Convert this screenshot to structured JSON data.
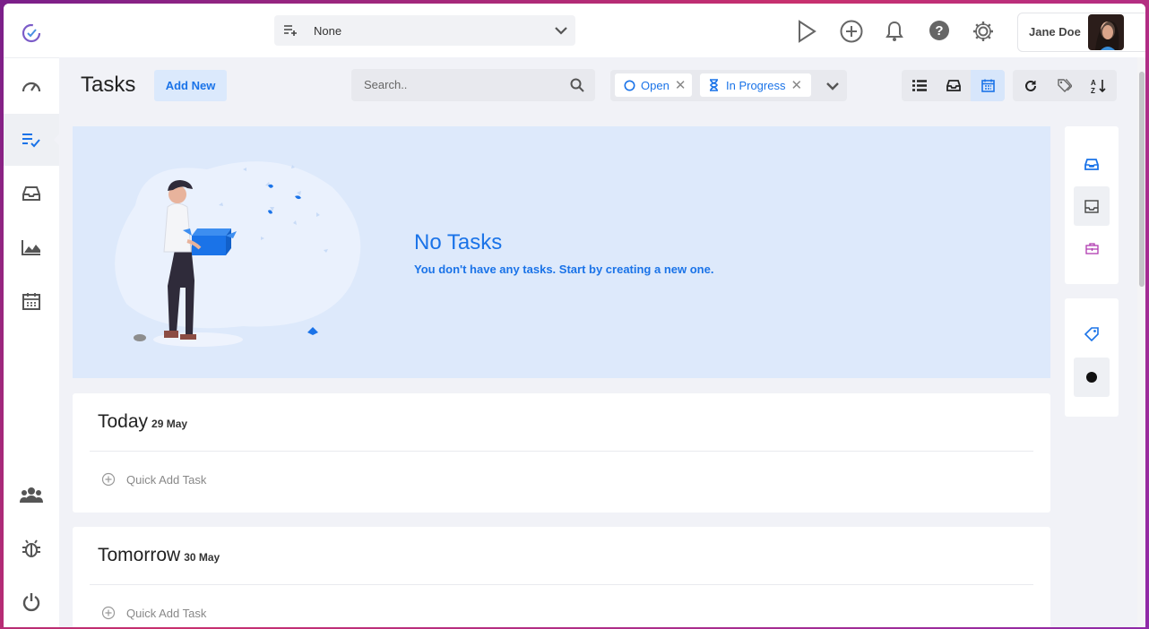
{
  "topbar": {
    "project_select": {
      "value": "None",
      "icon": "playlist-add-icon"
    },
    "icons": [
      "play-icon",
      "add-circle-icon",
      "bell-icon",
      "help-icon",
      "settings-icon"
    ],
    "user": {
      "name": "Jane Doe"
    }
  },
  "sidebar": {
    "items": [
      {
        "name": "dashboard",
        "icon": "speedometer-icon"
      },
      {
        "name": "tasks",
        "icon": "tasks-check-icon",
        "active": true
      },
      {
        "name": "inbox",
        "icon": "inbox-icon"
      },
      {
        "name": "reports",
        "icon": "area-chart-icon"
      },
      {
        "name": "calendar",
        "icon": "calendar-icon"
      },
      {
        "name": "team",
        "icon": "users-icon"
      },
      {
        "name": "bug-report",
        "icon": "bug-icon"
      },
      {
        "name": "logout",
        "icon": "power-icon"
      }
    ]
  },
  "header": {
    "title": "Tasks",
    "add_new_label": "Add New",
    "search_placeholder": "Search..",
    "filters": [
      {
        "label": "Open",
        "icon": "circle-outline-icon"
      },
      {
        "label": "In Progress",
        "icon": "hourglass-icon"
      }
    ],
    "view_buttons": [
      "list-view-icon",
      "inbox-view-icon",
      "calendar-view-icon"
    ],
    "active_view": "calendar-view-icon",
    "tool_buttons": [
      "refresh-icon",
      "tags-icon",
      "sort-az-icon"
    ]
  },
  "empty_state": {
    "title": "No Tasks",
    "subtitle": "You don't have any tasks. Start by creating a new one."
  },
  "days": [
    {
      "title": "Today",
      "date": "29 May",
      "quick_add": "Quick Add Task"
    },
    {
      "title": "Tomorrow",
      "date": "30 May",
      "quick_add": "Quick Add Task"
    }
  ],
  "right_panel": {
    "top_icons": [
      "inbox-blue-icon",
      "inbox-outline-icon",
      "briefcase-icon"
    ],
    "bottom_icons": [
      "tag-icon",
      "dot-icon"
    ]
  },
  "colors": {
    "accent": "#1a73e8",
    "empty_bg": "#dde9fb",
    "page_bg": "#f1f2f7"
  }
}
